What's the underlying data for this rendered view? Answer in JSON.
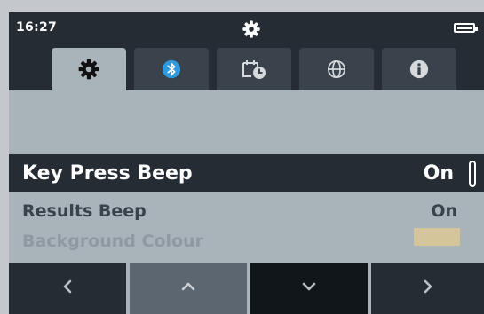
{
  "statusbar": {
    "time": "16:27",
    "center_icon": "gear-icon",
    "battery_icon": "battery-icon"
  },
  "tabs": [
    {
      "icon": "gear-icon",
      "active": true
    },
    {
      "icon": "bluetooth-icon",
      "active": false
    },
    {
      "icon": "calendar-clock-icon",
      "active": false
    },
    {
      "icon": "globe-icon",
      "active": false
    },
    {
      "icon": "info-icon",
      "active": false
    }
  ],
  "settings": [
    {
      "label": "Key Press Beep",
      "value": "On",
      "selected": true
    },
    {
      "label": "Results Beep",
      "value": "On",
      "selected": false
    },
    {
      "label": "Background Colour",
      "value_color": "#d4c59b",
      "selected": false
    }
  ],
  "softkeys": [
    {
      "icon": "chevron-left-icon"
    },
    {
      "icon": "chevron-up-icon"
    },
    {
      "icon": "chevron-down-icon"
    },
    {
      "icon": "chevron-right-icon"
    }
  ],
  "colors": {
    "dark": "#252c34",
    "panel": "#a9b3ba",
    "tab_inactive": "#3a434c",
    "bluetooth": "#2e9be0",
    "softkey_up_bg": "#5c6670"
  }
}
